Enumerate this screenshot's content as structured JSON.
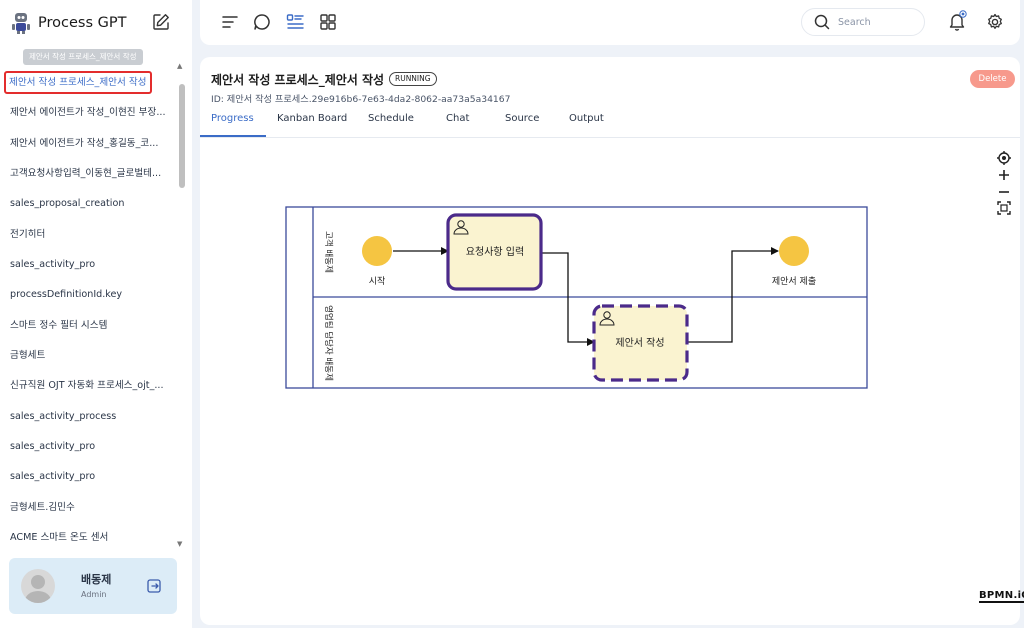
{
  "app": {
    "name": "Process GPT"
  },
  "sidebar": {
    "tooltip": "제안서 작성 프로세스_제안서 작성",
    "items": [
      {
        "label": "제안서 작성 프로세스_제안서 작성",
        "selected": true
      },
      {
        "label": "제안서 에이전트가 작성_이현진 부장..."
      },
      {
        "label": "제안서 에이전트가 작성_홍길동_코..."
      },
      {
        "label": "고객요청사항입력_이동현_글로벌테..."
      },
      {
        "label": "sales_proposal_creation"
      },
      {
        "label": "전기히터"
      },
      {
        "label": "sales_activity_pro"
      },
      {
        "label": "processDefinitionId.key"
      },
      {
        "label": "스마트 정수 필터 시스템"
      },
      {
        "label": "금형세트"
      },
      {
        "label": "신규직원 OJT 자동화 프로세스_ojt_..."
      },
      {
        "label": "sales_activity_process"
      },
      {
        "label": "sales_activity_pro"
      },
      {
        "label": "sales_activity_pro"
      },
      {
        "label": "금형세트.김민수"
      },
      {
        "label": "ACME 스마트 온도 센서"
      }
    ],
    "user": {
      "name": "배동제",
      "role": "Admin"
    }
  },
  "topbar": {
    "search_placeholder": "Search"
  },
  "main": {
    "title": "제안서 작성 프로세스_제안서 작성",
    "status": "RUNNING",
    "process_id": "ID: 제안서 작성 프로세스.29e916b6-7e63-4da2-8062-aa73a5a34167",
    "delete_label": "Delete",
    "tabs": [
      "Progress",
      "Kanban Board",
      "Schedule",
      "Chat",
      "Source",
      "Output"
    ],
    "active_tab": "Progress"
  },
  "diagram": {
    "lanes": [
      "고객 배동제",
      "영업팀 담당자 배동제"
    ],
    "start_label": "시작",
    "task1_label": "요청사항 입력",
    "task2_label": "제안서 작성",
    "end_label": "제안서 제출",
    "colors": {
      "event": "#f5c542",
      "task_fill": "#faf3d0",
      "task_border": "#4b2a8a",
      "pool_border": "#3b4a9a"
    }
  },
  "watermark": "BPMN.iO"
}
